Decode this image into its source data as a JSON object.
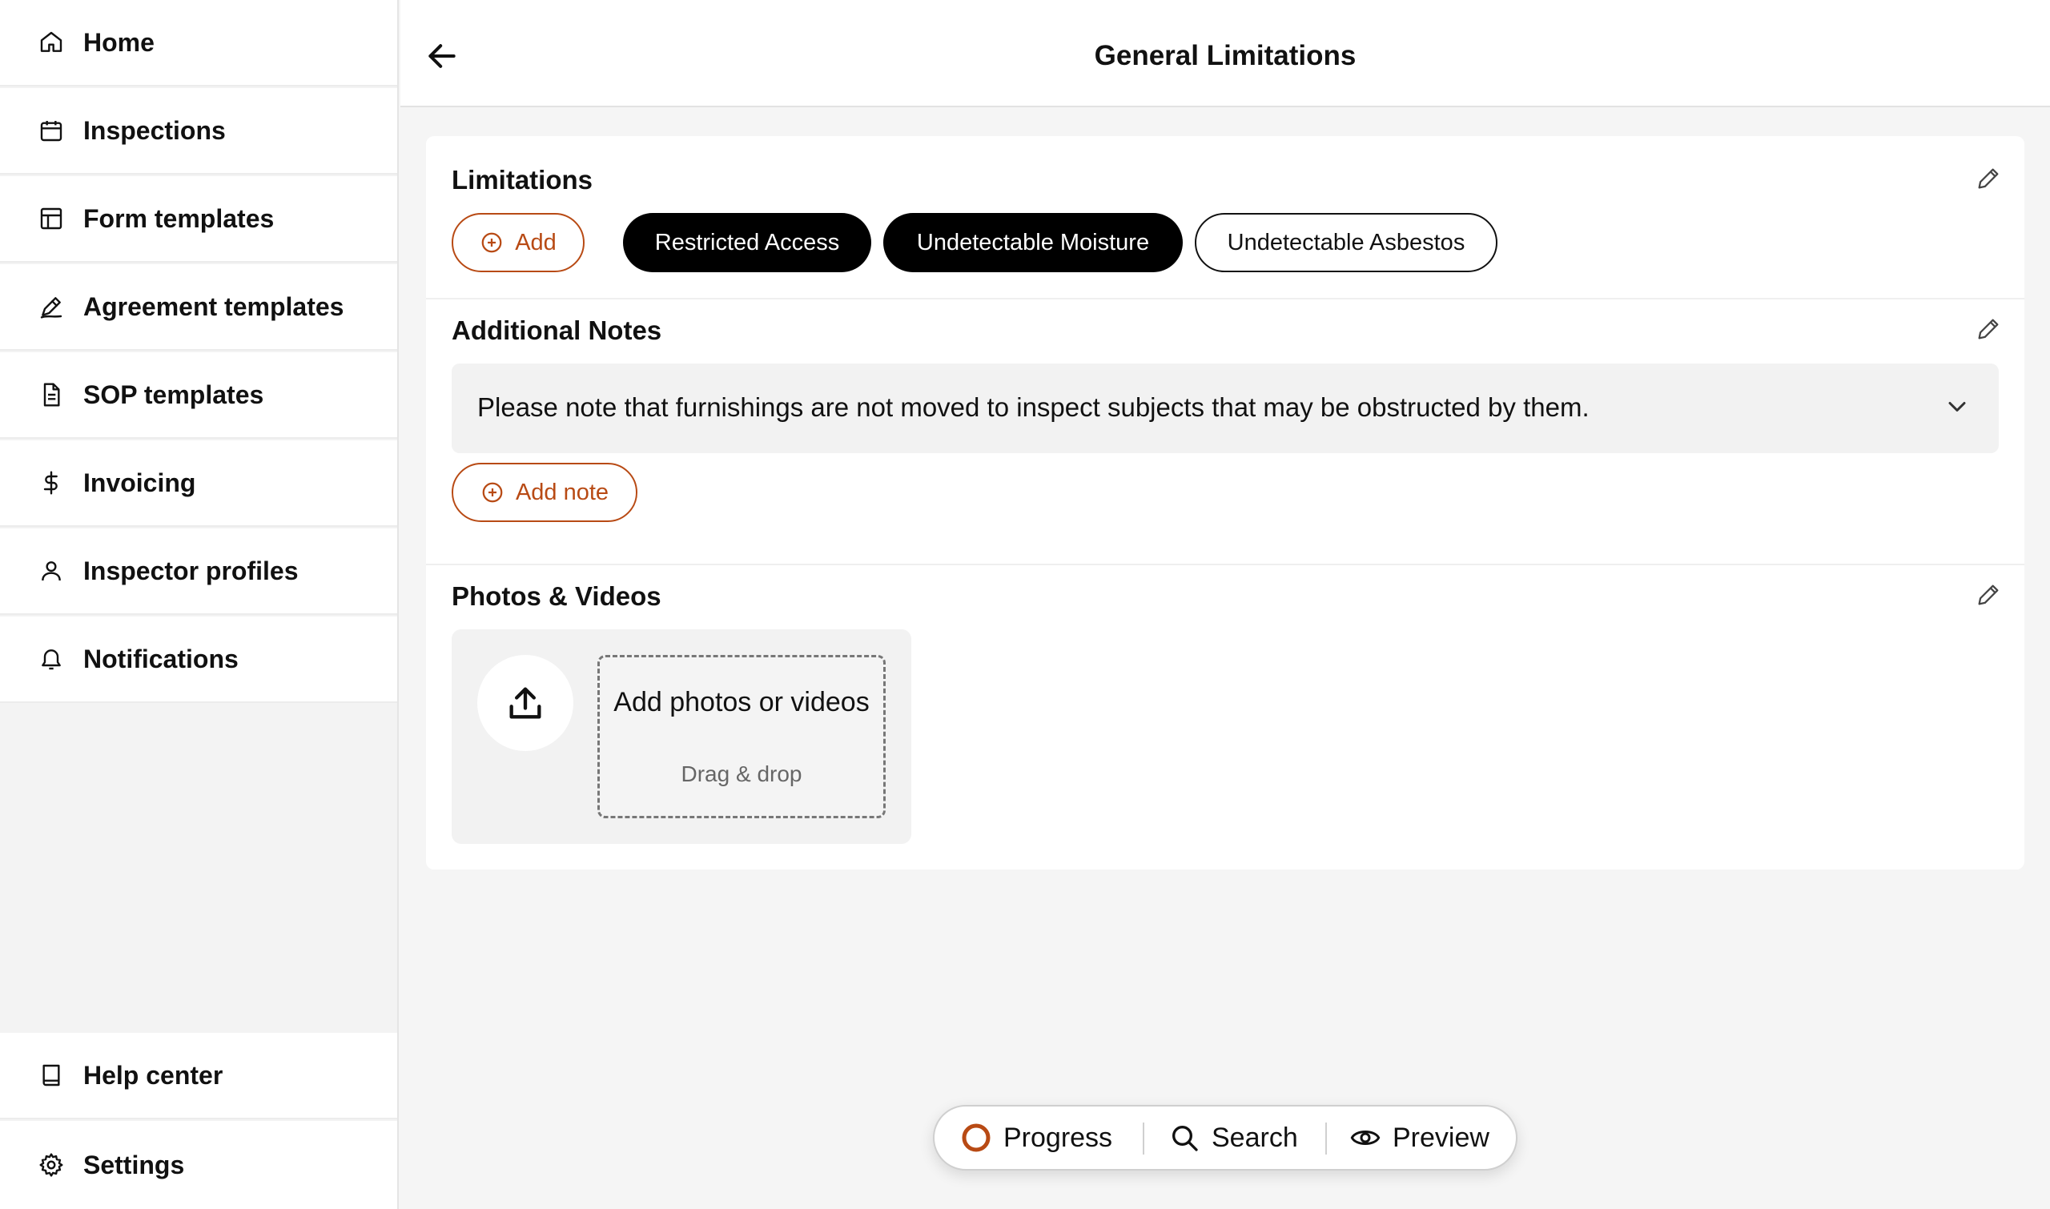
{
  "sidebar": {
    "items": [
      {
        "label": "Home",
        "icon": "home-icon"
      },
      {
        "label": "Inspections",
        "icon": "calendar-icon"
      },
      {
        "label": "Form templates",
        "icon": "layout-icon"
      },
      {
        "label": "Agreement templates",
        "icon": "signature-icon"
      },
      {
        "label": "SOP templates",
        "icon": "document-icon"
      },
      {
        "label": "Invoicing",
        "icon": "dollar-icon"
      },
      {
        "label": "Inspector profiles",
        "icon": "user-icon"
      },
      {
        "label": "Notifications",
        "icon": "bell-icon"
      }
    ],
    "bottom_items": [
      {
        "label": "Help center",
        "icon": "book-icon"
      },
      {
        "label": "Settings",
        "icon": "gear-icon"
      }
    ]
  },
  "header": {
    "title": "General Limitations"
  },
  "limitations": {
    "title": "Limitations",
    "add_label": "Add",
    "chips": [
      {
        "label": "Restricted Access",
        "selected": true
      },
      {
        "label": "Undetectable Moisture",
        "selected": true
      },
      {
        "label": "Undetectable Asbestos",
        "selected": false
      }
    ]
  },
  "notes": {
    "title": "Additional Notes",
    "note_text": "Please note that furnishings are not moved to inspect subjects that may be obstructed by them.",
    "add_note_label": "Add note"
  },
  "media": {
    "title": "Photos & Videos",
    "drop_title": "Add photos or videos",
    "drop_subtitle": "Drag & drop"
  },
  "toolbar": {
    "progress_label": "Progress",
    "search_label": "Search",
    "preview_label": "Preview"
  },
  "colors": {
    "accent": "#b84a14",
    "selected_chip": "#000000"
  }
}
